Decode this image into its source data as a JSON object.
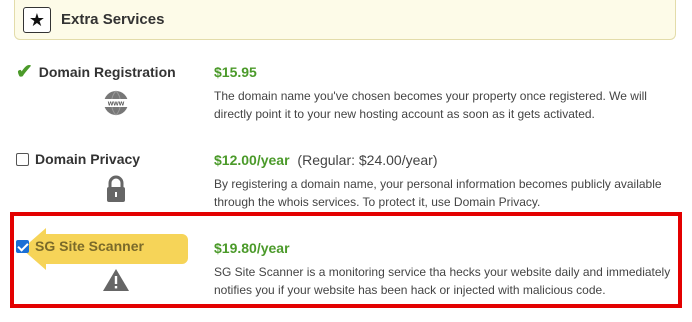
{
  "header": {
    "title": "Extra Services",
    "icon": "star-icon"
  },
  "services": [
    {
      "name": "Domain Registration",
      "status": "included",
      "price": "$15.95",
      "regular": "",
      "description_line1": "The domain name you've chosen becomes your property once registered. We will",
      "description_line2": "directly point it to your new hosting account as soon as it gets activated.",
      "icon": "www-globe-icon"
    },
    {
      "name": "Domain Privacy",
      "status": "unchecked",
      "price": "$12.00/year",
      "regular": "(Regular: $24.00/year)",
      "description_line1": "By registering a domain name, your personal information becomes publicly available",
      "description_line2": "through the whois services. To protect it, use Domain Privacy.",
      "icon": "lock-icon"
    },
    {
      "name": "SG Site Scanner",
      "status": "checked",
      "price": "$19.80/year",
      "regular": "",
      "description_line1": "SG Site Scanner is a monitoring service tha   hecks your website daily and immediately",
      "description_line2": "notifies you if your website has been hack    or injected with malicious code.",
      "icon": "warning-icon"
    }
  ],
  "colors": {
    "price_green": "#4b9a2a",
    "highlight_red": "#e30000",
    "arrow_yellow": "#f5d04a"
  }
}
